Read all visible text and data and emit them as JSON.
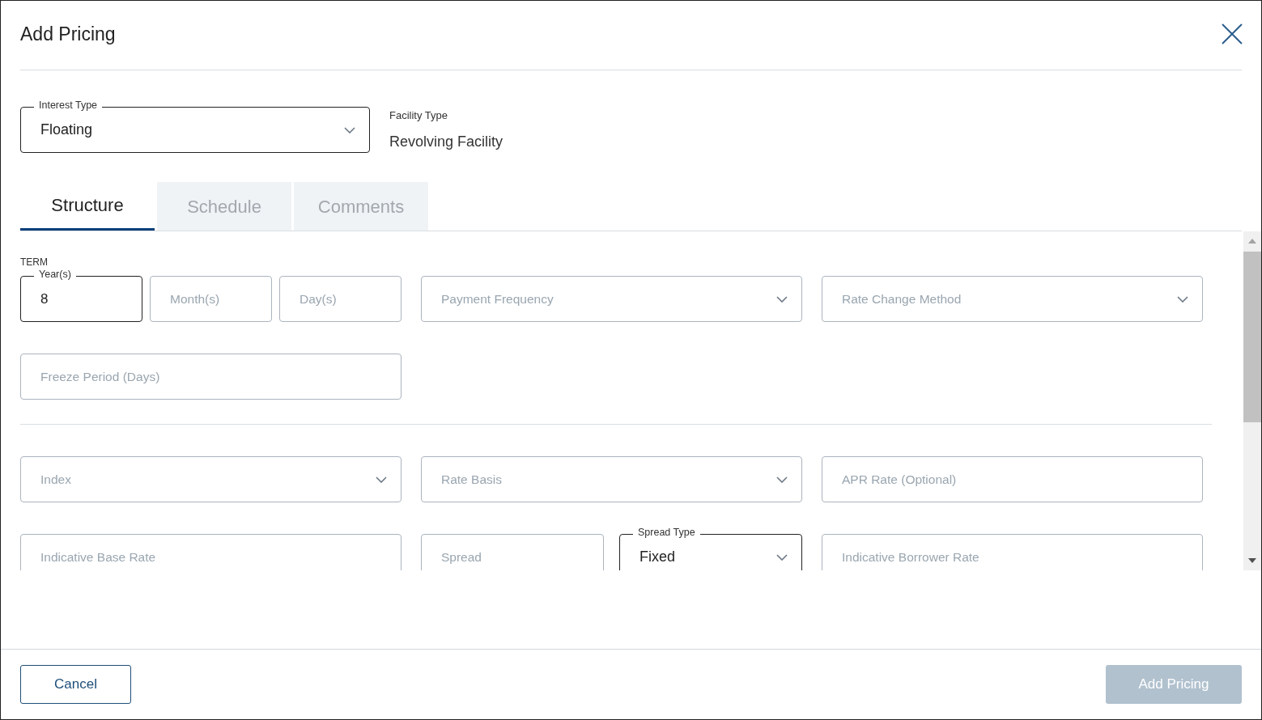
{
  "dialog": {
    "title": "Add Pricing"
  },
  "interest_type": {
    "kind": "select",
    "label": "Interest Type",
    "value": "Floating"
  },
  "facility_type": {
    "label": "Facility Type",
    "value": "Revolving Facility"
  },
  "tabs": [
    {
      "label": "Structure",
      "selected": true
    },
    {
      "label": "Schedule",
      "selected": false
    },
    {
      "label": "Comments",
      "selected": false
    }
  ],
  "structure": {
    "term": {
      "label": "TERM",
      "fields": [
        {
          "kind": "text",
          "label": "Year(s)",
          "value": "8"
        },
        {
          "kind": "text",
          "placeholder": "Month(s)"
        },
        {
          "kind": "text",
          "placeholder": "Day(s)"
        }
      ]
    },
    "payment_frequency": {
      "kind": "select",
      "placeholder": "Payment Frequency"
    },
    "rate_change_method": {
      "kind": "select",
      "placeholder": "Rate Change Method"
    },
    "freeze_period": {
      "kind": "text",
      "placeholder": "Freeze Period (Days)"
    },
    "index": {
      "kind": "select",
      "placeholder": "Index"
    },
    "rate_basis": {
      "kind": "select",
      "placeholder": "Rate Basis"
    },
    "apr_rate": {
      "kind": "text",
      "placeholder": "APR Rate (Optional)"
    },
    "indicative_base_rate": {
      "kind": "text",
      "placeholder": "Indicative Base Rate"
    },
    "spread": {
      "kind": "text",
      "placeholder": "Spread"
    },
    "spread_type": {
      "kind": "select",
      "label": "Spread Type",
      "value": "Fixed"
    },
    "indicative_borrower_rate": {
      "kind": "text",
      "placeholder": "Indicative Borrower Rate"
    }
  },
  "buttons": [
    {
      "label": "Cancel",
      "kind": "secondary",
      "disabled": false
    },
    {
      "label": "Add Pricing",
      "kind": "primary",
      "disabled": true
    }
  ]
}
